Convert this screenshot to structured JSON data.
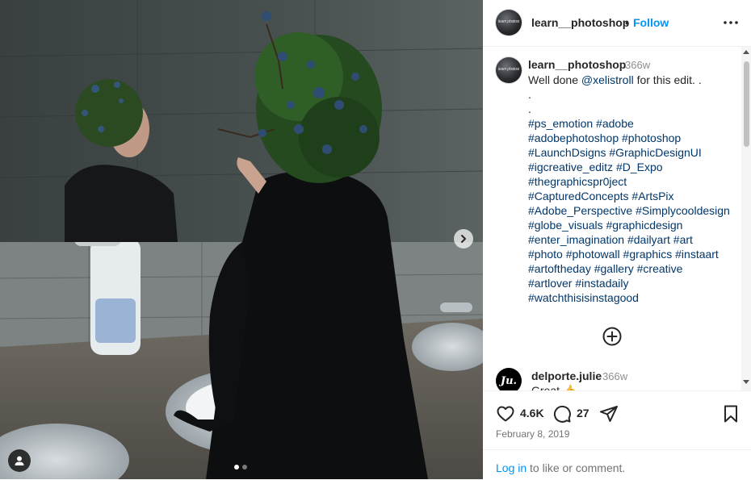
{
  "post": {
    "username": "learn__photoshop",
    "separator": "•",
    "follow_label": "Follow",
    "avatar_text": "learn photoshop",
    "more_icon": "more-horizontal-icon",
    "image_alt_icon": "photo",
    "carousel": {
      "total": 2,
      "current": 1
    }
  },
  "caption": {
    "username": "learn__photoshop",
    "time": "366w",
    "intro_before": "Well done ",
    "mention": "@xelistroll",
    "intro_after": " for this edit. .",
    "dot_lines": [
      ".",
      "."
    ],
    "hashtag_lines": [
      "#ps_emotion #adobe",
      "#adobephotoshop #photoshop",
      "#LaunchDsigns #GraphicDesignUI",
      "#igcreative_editz #D_Expo",
      "#thegraphicspr0ject",
      "#CapturedConcepts #ArtsPix",
      "#Adobe_Perspective #Simplycooldesign",
      "#globe_visuals #graphicdesign",
      "#enter_imagination #dailyart #art",
      "#photo #photowall #graphics #instaart",
      "#artoftheday #gallery #creative",
      "#artlover #instadaily",
      "#watchthisisinstagood"
    ]
  },
  "comment": {
    "avatar_text": "Ju.",
    "username": "delporte.julie",
    "time": "366w",
    "text": "Great 👍"
  },
  "actions": {
    "likes": "4.6K",
    "comments": "27",
    "date": "February 8, 2019"
  },
  "login": {
    "link": "Log in",
    "rest": " to like or comment."
  },
  "colors": {
    "accent": "#0095f6",
    "hashtag": "#00376b",
    "muted": "#737373"
  }
}
